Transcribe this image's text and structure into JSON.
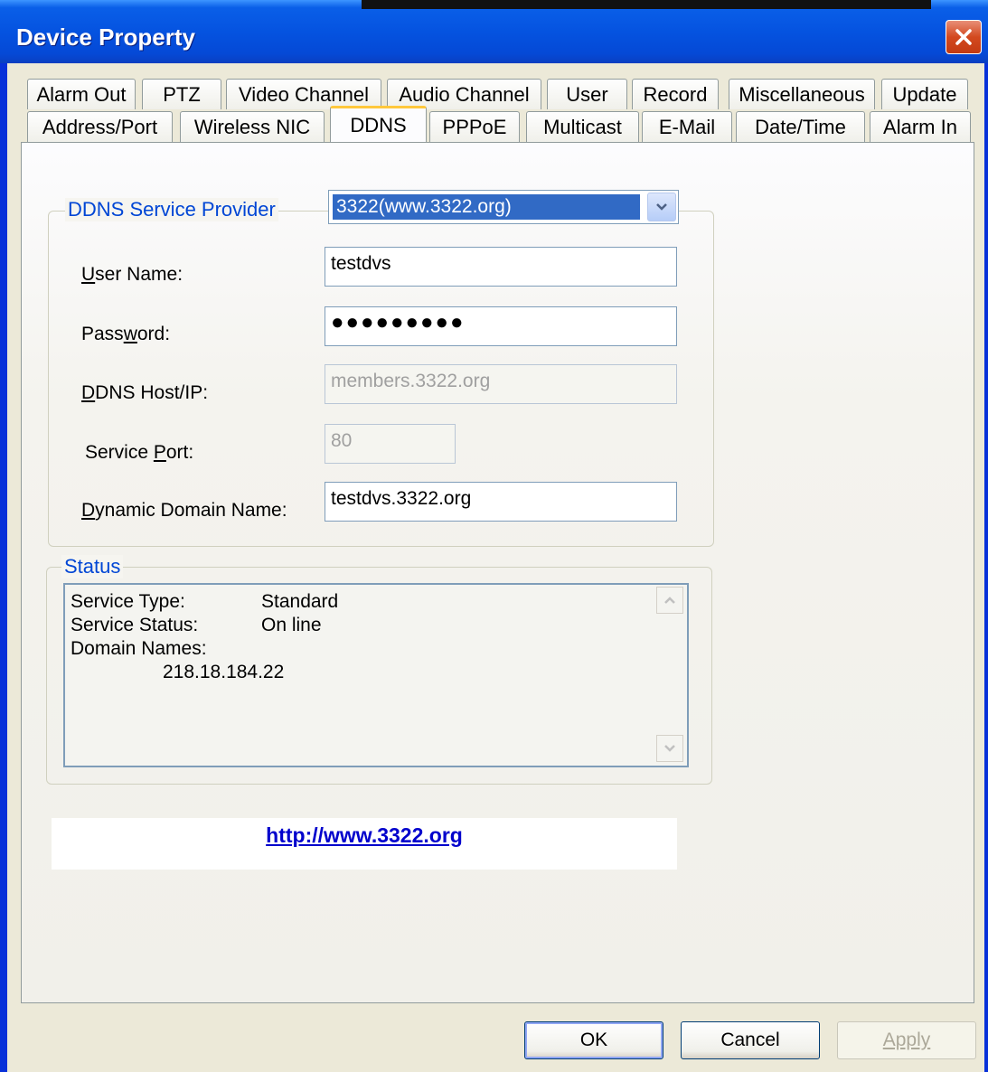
{
  "window": {
    "title": "Device Property"
  },
  "tabs_row1": [
    "Alarm Out",
    "PTZ",
    "Video Channel",
    "Audio Channel",
    "User",
    "Record",
    "Miscellaneous",
    "Update"
  ],
  "tabs_row2": [
    "Address/Port",
    "Wireless NIC",
    "DDNS",
    "PPPoE",
    "Multicast",
    "E-Mail",
    "Date/Time",
    "Alarm In"
  ],
  "active_tab": "DDNS",
  "ddns": {
    "group_label": "DDNS Service Provider",
    "provider_selected": "3322(www.3322.org)",
    "user_name_label": "User Name:",
    "user_name_value": "testdvs",
    "password_label": "Password:",
    "password_value": "●●●●●●●●●",
    "host_label": "DDNS Host/IP:",
    "host_value": "members.3322.org",
    "port_label": "Service Port:",
    "port_value": "80",
    "domain_label": "Dynamic Domain Name:",
    "domain_value": "testdvs.3322.org"
  },
  "status": {
    "group_label": "Status",
    "service_type_label": "Service Type:",
    "service_type_value": "Standard",
    "service_status_label": "Service Status:",
    "service_status_value": "On line",
    "domain_names_label": "Domain Names:",
    "domain_names_value": "218.18.184.22"
  },
  "link": {
    "text": "http://www.3322.org"
  },
  "buttons": {
    "ok": "OK",
    "cancel": "Cancel",
    "apply": "Apply"
  }
}
